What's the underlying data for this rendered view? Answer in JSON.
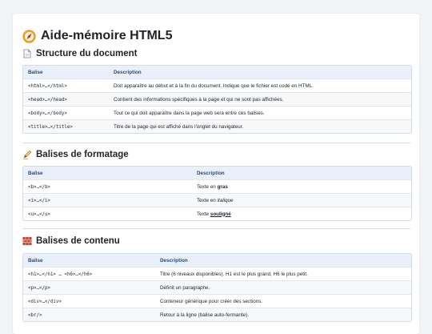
{
  "page": {
    "title": "Aide-mémoire HTML5",
    "icon": "compass-icon"
  },
  "sections": [
    {
      "title": "Structure du document",
      "icon": "document-icon",
      "headers": [
        "Balise",
        "Description"
      ],
      "rows": [
        [
          "<html>…</html>",
          "Doit apparaître au début et à la fin du document. Indique que le fichier est codé en HTML."
        ],
        [
          "<head>…</head>",
          "Contient des informations spécifiques à la page et qui ne sont pas affichées."
        ],
        [
          "<body>…</body>",
          "Tout ce qui doit apparaître dans la page web sera entre ces balises."
        ],
        [
          "<title>…</title>",
          "Titre de la page qui est affiché dans l'onglet du navigateur."
        ]
      ]
    },
    {
      "title": "Balises de formatage",
      "icon": "writing-hand-icon",
      "headers": [
        "Balise",
        "Description"
      ],
      "rows": [
        [
          "<b>…</b>",
          "Texte en ",
          "gras"
        ],
        [
          "<i>…</i>",
          "Texte en ",
          "italique"
        ],
        [
          "<u>…</u>",
          "Texte ",
          "souligné"
        ]
      ]
    },
    {
      "title": "Balises de contenu",
      "icon": "brick-icon",
      "headers": [
        "Balise",
        "Description"
      ],
      "rows": [
        [
          "<h1>…</h1> … <h6>…</h6>",
          "Titre (6 niveaux disponibles). H1 est le plus grand, H6 le plus petit."
        ],
        [
          "<p>…</p>",
          "Définit un paragraphe."
        ],
        [
          "<div>…</div>",
          "Conteneur générique pour créer des sections."
        ],
        [
          "<br/>",
          "Retour à la ligne (balise auto-fermante)."
        ]
      ]
    }
  ]
}
